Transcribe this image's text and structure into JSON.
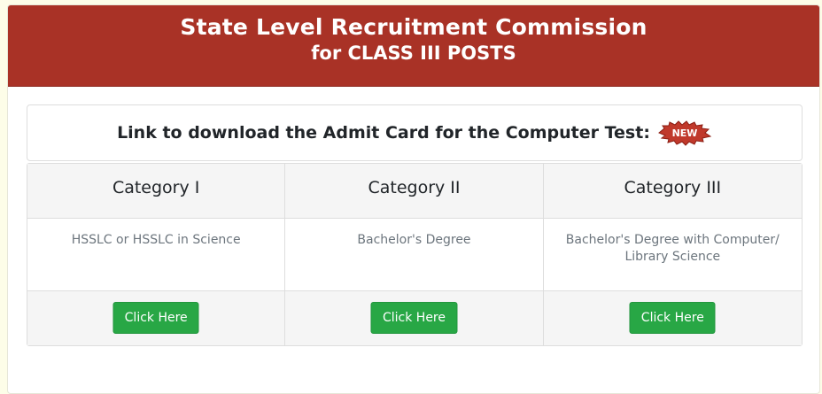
{
  "header": {
    "title": "State Level Recruitment Commission",
    "subtitle": "for CLASS III POSTS"
  },
  "notice": {
    "text": "Link to download the Admit Card for the Computer Test:",
    "badge": "NEW"
  },
  "categories": [
    {
      "title": "Category I",
      "description": "HSSLC or HSSLC in Science",
      "button": "Click Here"
    },
    {
      "title": "Category II",
      "description": "Bachelor's Degree",
      "button": "Click Here"
    },
    {
      "title": "Category III",
      "description": "Bachelor's Degree with Computer/ Library Science",
      "button": "Click Here"
    }
  ],
  "colors": {
    "header_bg": "#a93226",
    "button_bg": "#28a745",
    "page_bg": "#fdfde8"
  }
}
